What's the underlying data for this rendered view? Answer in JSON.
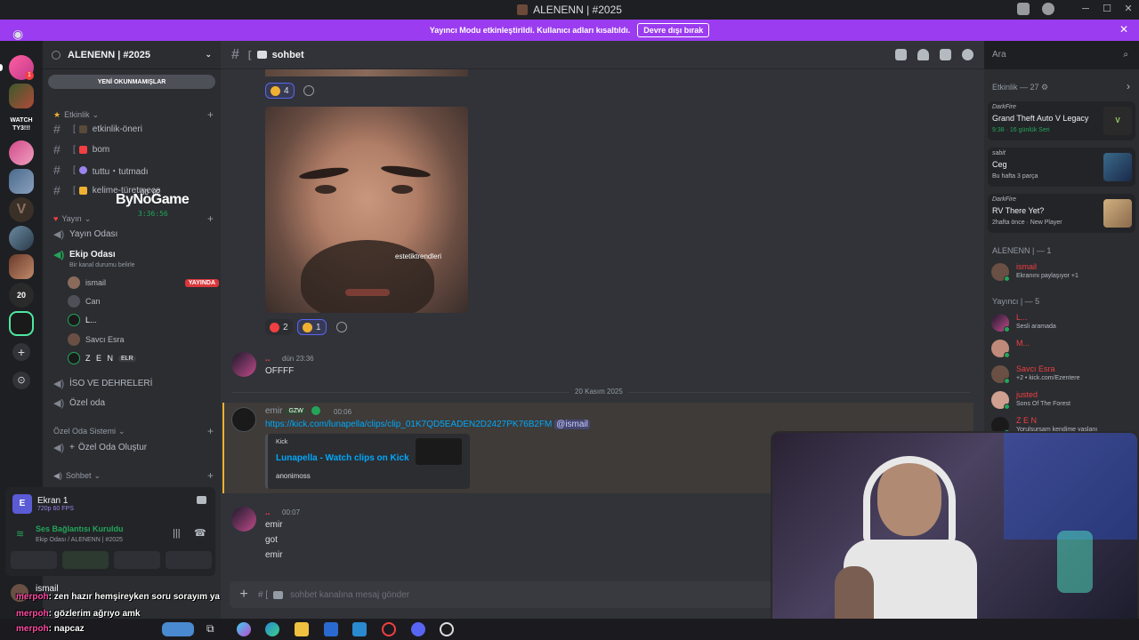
{
  "window": {
    "title": "ALENENN | #2025"
  },
  "banner": {
    "text": "Yayıncı Modu etkinleştirildi. Kullanıcı adları kısaltıldı.",
    "button": "Devre dışı bırak"
  },
  "server": {
    "name": "ALENENN | #2025",
    "new_unreads": "YENİ OKUNMAMIŞLAR"
  },
  "categories": {
    "etkinlik": "Etkinlik",
    "yayin": "Yayın",
    "ozel": "Özel Oda Sistemi",
    "sohbet": "Sohbet"
  },
  "channels": {
    "etkinlik_oneri": "etkinlik-öneri",
    "bom": "bom",
    "tuttu": "tuttu・tutmadı",
    "kelime": "kelime-türetmece",
    "yayin_odasi": "Yayın Odası",
    "ekip_odasi": "Ekip Odası",
    "ekip_status": "Bir kanal durumu belirle",
    "iso": "İSO VE DEHRELERİ",
    "ozel_oda": "Özel oda",
    "ozel_olustur": "Özel Oda Oluştur"
  },
  "voice_users": [
    {
      "name": "ismail",
      "badge": "YAYINDA"
    },
    {
      "name": "Can"
    },
    {
      "name": "L..."
    },
    {
      "name": "Savcı Esra"
    },
    {
      "name": "Z E N",
      "tag": "ELR"
    }
  ],
  "overlay": {
    "logo": "ByNoGame",
    "count_a": "00",
    "count_b": "02",
    "timer": "3:36:56"
  },
  "user_panel": {
    "screen_title": "Ekran 1",
    "screen_sub": "720p 60 FPS",
    "voice_status": "Ses Bağlantısı Kuruldu",
    "voice_sub": "Ekip Odası / ALENENN | #2025",
    "user": "ismail"
  },
  "chat_header": {
    "channel": "sohbet"
  },
  "search": {
    "placeholder": "Ara"
  },
  "reactions": {
    "r1": "4",
    "r2": "2",
    "r3": "1"
  },
  "image_watermark": "estetiktrendleri",
  "messages": [
    {
      "time": "dün 23:36",
      "text": "OFFFF"
    },
    {
      "date": "20 Kasım 2025"
    },
    {
      "author": "emir",
      "tag": "GZW",
      "time": "00:06",
      "link": "https://kick.com/lunapella/clips/clip_01K7QD5EADEN2D2427PK76B2FM",
      "mention": "@ismail",
      "embed": {
        "provider": "Kick",
        "title": "Lunapella - Watch clips on Kick",
        "desc": "anonimoss"
      }
    },
    {
      "time": "00:07",
      "lines": [
        "emir",
        "got",
        "emir"
      ]
    }
  ],
  "composer": {
    "placeholder": "sohbet kanalına mesaj gönder"
  },
  "members": {
    "activity_header": "Etkinlik — 27",
    "activities": [
      {
        "user": "DarkFire",
        "game": "Grand Theft Auto V Legacy",
        "sub": "9:38 · 16 günlük Seri"
      },
      {
        "user": "sabit",
        "game": "Ceg",
        "sub": "Bu hafta 3 parça"
      },
      {
        "user": "DarkFire",
        "game": "RV There Yet?",
        "sub": "2hafta önce · New Player"
      }
    ],
    "group1": "ALENENN | — 1",
    "g1_member": {
      "name": "ismail",
      "status": "Ekranını paylaşıyor +1"
    },
    "group2": "Yayıncı | — 5",
    "g2_members": [
      {
        "name": "L...",
        "status": "Sesli aramada"
      },
      {
        "name": "M...",
        "status": ""
      },
      {
        "name": "Savcı Esra",
        "status": "+2 • kick.com/Ezentere"
      },
      {
        "name": "justed",
        "status": "Sons Of The Forest"
      },
      {
        "name": "Z E N",
        "status": "Yorulsursam kendime yaslanı"
      }
    ]
  },
  "stream_chat": [
    {
      "name": "merpoh",
      "text": ": zen hazır hemşireyken soru sorayım ya"
    },
    {
      "name": "merpoh",
      "text": ": gözlerim ağrıyo amk"
    },
    {
      "name": "merpoh",
      "text": ": napcaz"
    }
  ],
  "colors": {
    "accent": "#5865f2",
    "banner": "#9b3cf0",
    "online": "#23a559",
    "live": "#da373c"
  }
}
